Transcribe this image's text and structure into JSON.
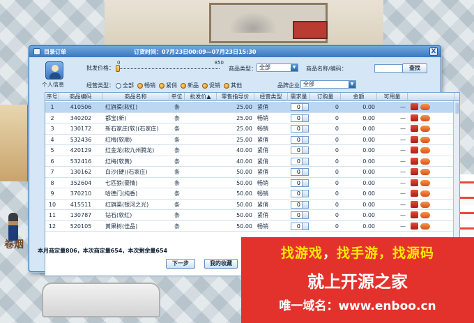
{
  "dialog": {
    "title": "目录订单",
    "order_time": "订货时间：07月23日00:09—07月23日15:30",
    "close_label": "X"
  },
  "filters": {
    "profile_label": "个人信息",
    "price_label": "批发价格：",
    "price_min": "0",
    "price_max": "850",
    "product_type_label": "商品类型：",
    "product_type_value": "全部",
    "product_name_label": "商品名称/编码：",
    "product_name_value": "",
    "search_label": "查找",
    "business_type_label": "经营类型：",
    "business_types": [
      "全部",
      "畅销",
      "紧俏",
      "新品",
      "促销",
      "其他"
    ],
    "business_type_selected": "全部",
    "brand_label": "品牌企业：",
    "brand_value": "全部"
  },
  "table": {
    "headers": [
      "序号",
      "商品编码",
      "商品名称",
      "单位",
      "批发价",
      "零售指导价",
      "经营类型",
      "需求量",
      "订购量",
      "金额",
      "可用量"
    ],
    "sort_indicator": "▲",
    "rows": [
      {
        "no": "1",
        "code": "410506",
        "name": "红旗渠(软红)",
        "unit": "条",
        "retail": "25.00",
        "type": "紧俏",
        "demand": "0",
        "order": "0",
        "amount": "0.00",
        "avail": "—"
      },
      {
        "no": "2",
        "code": "340202",
        "name": "都宝(新)",
        "unit": "条",
        "retail": "25.00",
        "type": "畅销",
        "demand": "0",
        "order": "0",
        "amount": "0.00",
        "avail": "—"
      },
      {
        "no": "3",
        "code": "130172",
        "name": "新石家庄(软)(石家庄)",
        "unit": "条",
        "retail": "25.00",
        "type": "畅销",
        "demand": "0",
        "order": "0",
        "amount": "0.00",
        "avail": "—"
      },
      {
        "no": "4",
        "code": "532436",
        "name": "红梅(软顺)",
        "unit": "条",
        "retail": "25.00",
        "type": "紧俏",
        "demand": "0",
        "order": "0",
        "amount": "0.00",
        "avail": "—"
      },
      {
        "no": "5",
        "code": "420129",
        "name": "红金龙(软九州腾龙)",
        "unit": "条",
        "retail": "40.00",
        "type": "紧俏",
        "demand": "0",
        "order": "0",
        "amount": "0.00",
        "avail": "—"
      },
      {
        "no": "6",
        "code": "532416",
        "name": "红梅(软黄)",
        "unit": "条",
        "retail": "40.00",
        "type": "紧俏",
        "demand": "0",
        "order": "0",
        "amount": "0.00",
        "avail": "—"
      },
      {
        "no": "7",
        "code": "130162",
        "name": "白沙(硬)(石家庄)",
        "unit": "条",
        "retail": "50.00",
        "type": "紧俏",
        "demand": "0",
        "order": "0",
        "amount": "0.00",
        "avail": "—"
      },
      {
        "no": "8",
        "code": "352604",
        "name": "七匹狼(豪情)",
        "unit": "条",
        "retail": "50.00",
        "type": "畅销",
        "demand": "0",
        "order": "0",
        "amount": "0.00",
        "avail": "—"
      },
      {
        "no": "9",
        "code": "370210",
        "name": "哈德门(纯香)",
        "unit": "条",
        "retail": "50.00",
        "type": "畅销",
        "demand": "0",
        "order": "0",
        "amount": "0.00",
        "avail": "—"
      },
      {
        "no": "10",
        "code": "415511",
        "name": "红旗渠(银河之光)",
        "unit": "条",
        "retail": "50.00",
        "type": "紧俏",
        "demand": "0",
        "order": "0",
        "amount": "0.00",
        "avail": "—"
      },
      {
        "no": "11",
        "code": "130787",
        "name": "钻石(软红)",
        "unit": "条",
        "retail": "50.00",
        "type": "紧俏",
        "demand": "0",
        "order": "0",
        "amount": "0.00",
        "avail": "—"
      },
      {
        "no": "12",
        "code": "520105",
        "name": "黄果树(佳品)",
        "unit": "条",
        "retail": "50.00",
        "type": "畅销",
        "demand": "0",
        "order": "0",
        "amount": "0.00",
        "avail": "—"
      }
    ]
  },
  "summary": "本月商定量806，本次商定量654，本次剩余量654",
  "buttons": {
    "next": "下一步",
    "favorites": "我的收藏"
  },
  "banner": {
    "line1_part1": "找游戏",
    "line1_sep": "，",
    "line1_part2": "找手游，找源码",
    "line2": "就上开源之家",
    "line3": "唯一域名：www.enboo.cn"
  },
  "colors": {
    "dialog_bg": "#d5e7f6",
    "titlebar": "#3a78bf",
    "selected_row": "#bcd7f2",
    "banner": "#e3322c",
    "banner_highlight": "#ffe900"
  },
  "icons": [
    "user-icon",
    "close-icon",
    "dropdown-icon",
    "gift-icon",
    "tag-icon"
  ]
}
